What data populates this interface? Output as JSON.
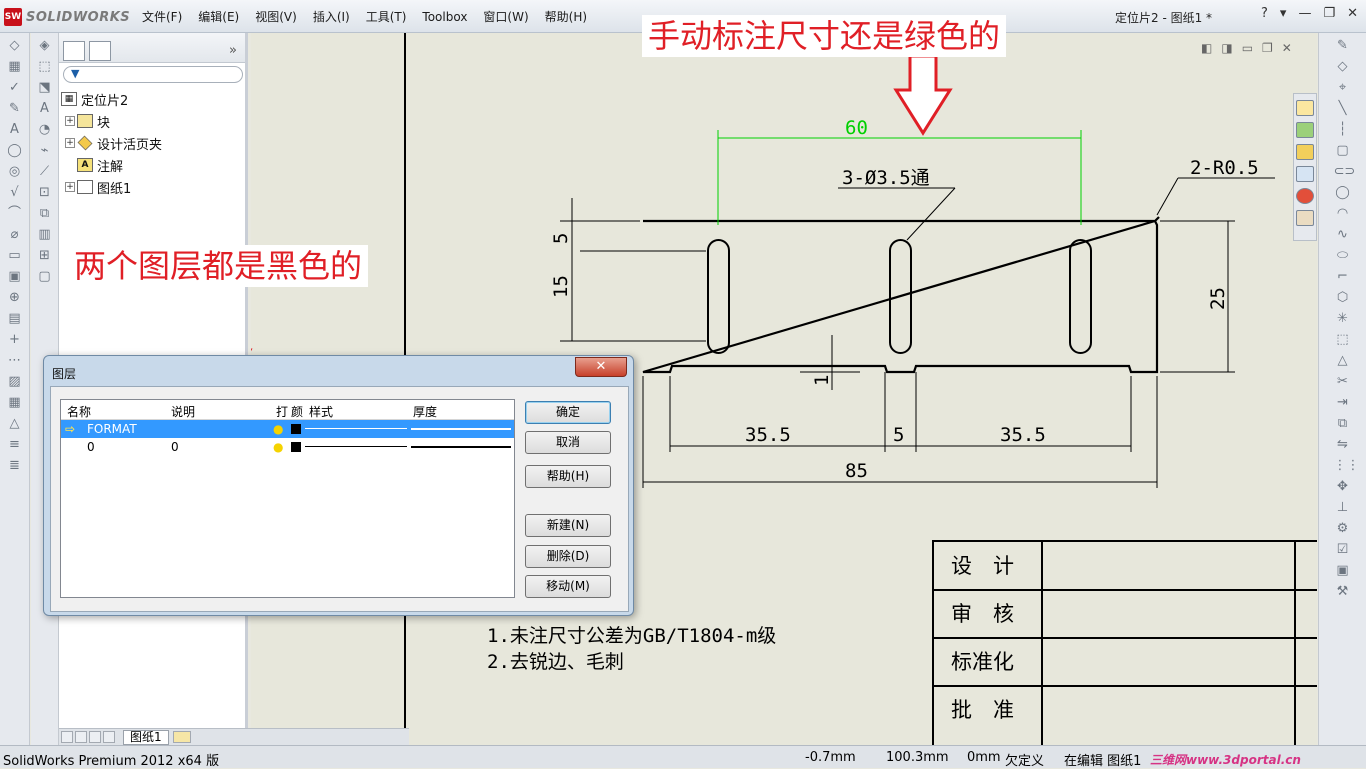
{
  "app": {
    "logo": "SOLIDWORKS",
    "logo_badge": "SW",
    "menus": [
      "文件(F)",
      "编辑(E)",
      "视图(V)",
      "插入(I)",
      "工具(T)",
      "Toolbox",
      "窗口(W)",
      "帮助(H)"
    ],
    "doc_title": "定位片2 - 图纸1 *",
    "window_buttons": [
      "?",
      "▾",
      "—",
      "❐",
      "✕"
    ]
  },
  "feature_tree": {
    "root": "定位片2",
    "items": [
      {
        "label": "块",
        "expand": "+",
        "icon": "block-folder-icon"
      },
      {
        "label": "设计活页夹",
        "expand": "+",
        "icon": "design-binder-icon"
      },
      {
        "label": "注解",
        "expand": "",
        "icon": "annotation-icon"
      },
      {
        "label": "图纸1",
        "expand": "+",
        "icon": "sheet-icon"
      }
    ]
  },
  "callouts": {
    "top": "手动标注尺寸还是绿色的",
    "left": "两个图层都是黑色的"
  },
  "drawing": {
    "dim_green": "60",
    "hole_note": "3-Ø3.5通",
    "radius_note": "2-R0.5",
    "dim_5_left": "5",
    "dim_15": "15",
    "dim_25": "25",
    "dim_1": "1",
    "dim_35_left": "35.5",
    "dim_5_mid": "5",
    "dim_35_right": "35.5",
    "dim_85": "85",
    "notes": [
      "1.未注尺寸公差为GB/T1804-m级",
      "2.去锐边、毛刺"
    ],
    "title_block": [
      "设　计",
      "审　核",
      "标准化",
      "批　准"
    ],
    "colors": {
      "green_dim": "#00d000",
      "line": "#000000"
    }
  },
  "dialog": {
    "title": "图层",
    "close": "✕",
    "columns": {
      "name": "名称",
      "desc": "说明",
      "on": "打",
      "color": "颜",
      "style": "样式",
      "thickness": "厚度"
    },
    "rows": [
      {
        "name": "FORMAT",
        "desc": "",
        "selected": true
      },
      {
        "name": "0",
        "desc": "0",
        "selected": false
      }
    ],
    "buttons": {
      "ok": "确定",
      "cancel": "取消",
      "help": "帮助(H)",
      "new": "新建(N)",
      "delete": "删除(D)",
      "move": "移动(M)"
    }
  },
  "sheet_tabs": {
    "active": "图纸1"
  },
  "status": {
    "app": "SolidWorks Premium 2012 x64 版",
    "x": "-0.7mm",
    "y": "100.3mm",
    "z": "0mm",
    "state": "欠定义",
    "editing": "在编辑 图纸1",
    "watermark": "三维网www.3dportal.cn"
  }
}
